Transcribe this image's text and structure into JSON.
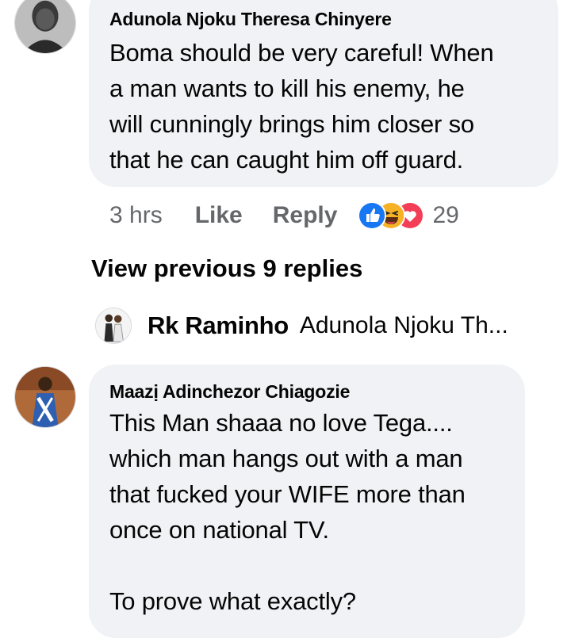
{
  "comments": [
    {
      "author": "Adunola Njoku Theresa Chinyere",
      "text": "Boma should be very careful!  When\na man wants to kill his enemy, he\nwill cunningly brings him closer so\nthat he can caught him off guard."
    },
    {
      "author": "Maazị Adinchezor Chiagozie",
      "text": "This Man shaaa no love Tega....\nwhich man hangs out with a man\nthat fucked your WIFE more than\nonce on national TV.\n\nTo prove what exactly?"
    }
  ],
  "actions": {
    "time": "3 hrs",
    "like": "Like",
    "reply": "Reply",
    "reaction_count": "29",
    "reaction_icons": [
      "like-icon",
      "haha-icon",
      "love-icon"
    ]
  },
  "view_previous": "View previous 9 replies",
  "latest_reply": {
    "author": "Rk Raminho",
    "preview": "Adunola Njoku Th..."
  },
  "colors": {
    "bubble": "#f0f2f5",
    "secondary_text": "#65676b",
    "like_blue": "#1877f2",
    "love_red": "#f33e58",
    "haha_yellow": "#f7b125"
  }
}
